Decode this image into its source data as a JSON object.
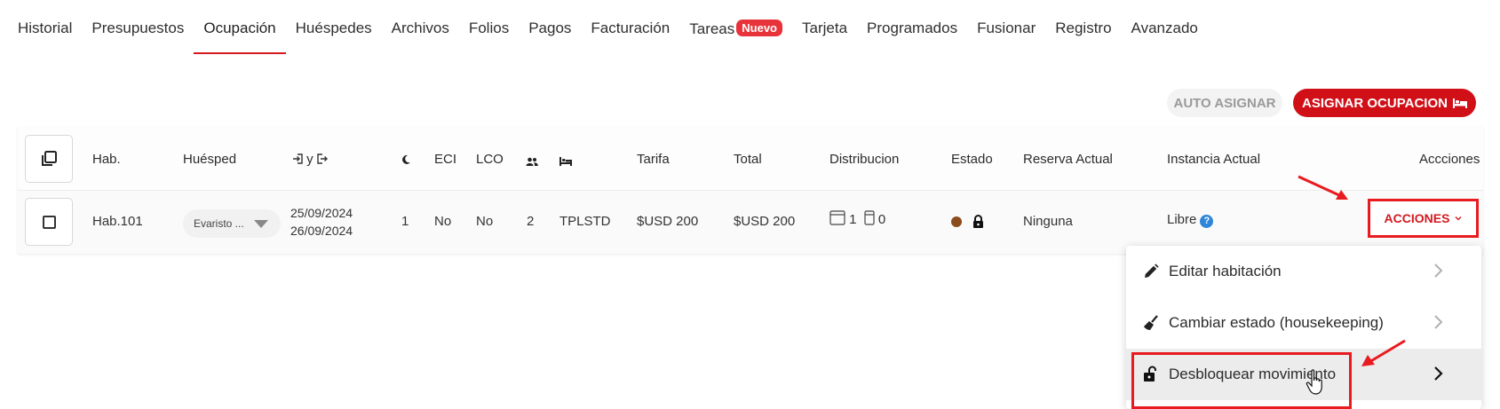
{
  "tabs": [
    {
      "label": "Historial"
    },
    {
      "label": "Presupuestos"
    },
    {
      "label": "Ocupación"
    },
    {
      "label": "Huéspedes"
    },
    {
      "label": "Archivos"
    },
    {
      "label": "Folios"
    },
    {
      "label": "Pagos"
    },
    {
      "label": "Facturación"
    },
    {
      "label": "Tareas",
      "badge": "Nuevo"
    },
    {
      "label": "Tarjeta"
    },
    {
      "label": "Programados"
    },
    {
      "label": "Fusionar"
    },
    {
      "label": "Registro"
    },
    {
      "label": "Avanzado"
    }
  ],
  "active_tab": "Ocupación",
  "toolbar": {
    "auto_assign_label": "AUTO ASIGNAR",
    "assign_label": "ASIGNAR OCUPACION"
  },
  "table": {
    "headers": {
      "room": "Hab.",
      "guest": "Huésped",
      "dates": "y",
      "eci": "ECI",
      "lco": "LCO",
      "rate": "Tarifa",
      "total": "Total",
      "distribution": "Distribucion",
      "status": "Estado",
      "current_booking": "Reserva Actual",
      "current_instance": "Instancia Actual",
      "actions": "Accciones"
    },
    "row": {
      "room": "Hab.101",
      "guest": "Evaristo ...",
      "checkin": "25/09/2024",
      "checkout": "26/09/2024",
      "nights": "1",
      "eci": "No",
      "lco": "No",
      "pax": "2",
      "room_type": "TPLSTD",
      "rate": "$USD 200",
      "total": "$USD 200",
      "dist_a": "1",
      "dist_b": "0",
      "current_booking": "Ninguna",
      "current_instance": "Libre",
      "actions_label": "ACCIONES"
    }
  },
  "menu": {
    "items": [
      {
        "label": "Editar habitación",
        "icon": "pencil-icon"
      },
      {
        "label": "Cambiar estado (housekeeping)",
        "icon": "broom-icon"
      },
      {
        "label": "Desbloquear movimiento",
        "icon": "unlock-icon"
      }
    ]
  },
  "colors": {
    "accent": "#d00f17",
    "annotation": "#e81b20",
    "status_dot": "#8a4b1d",
    "help": "#2d86d9"
  }
}
